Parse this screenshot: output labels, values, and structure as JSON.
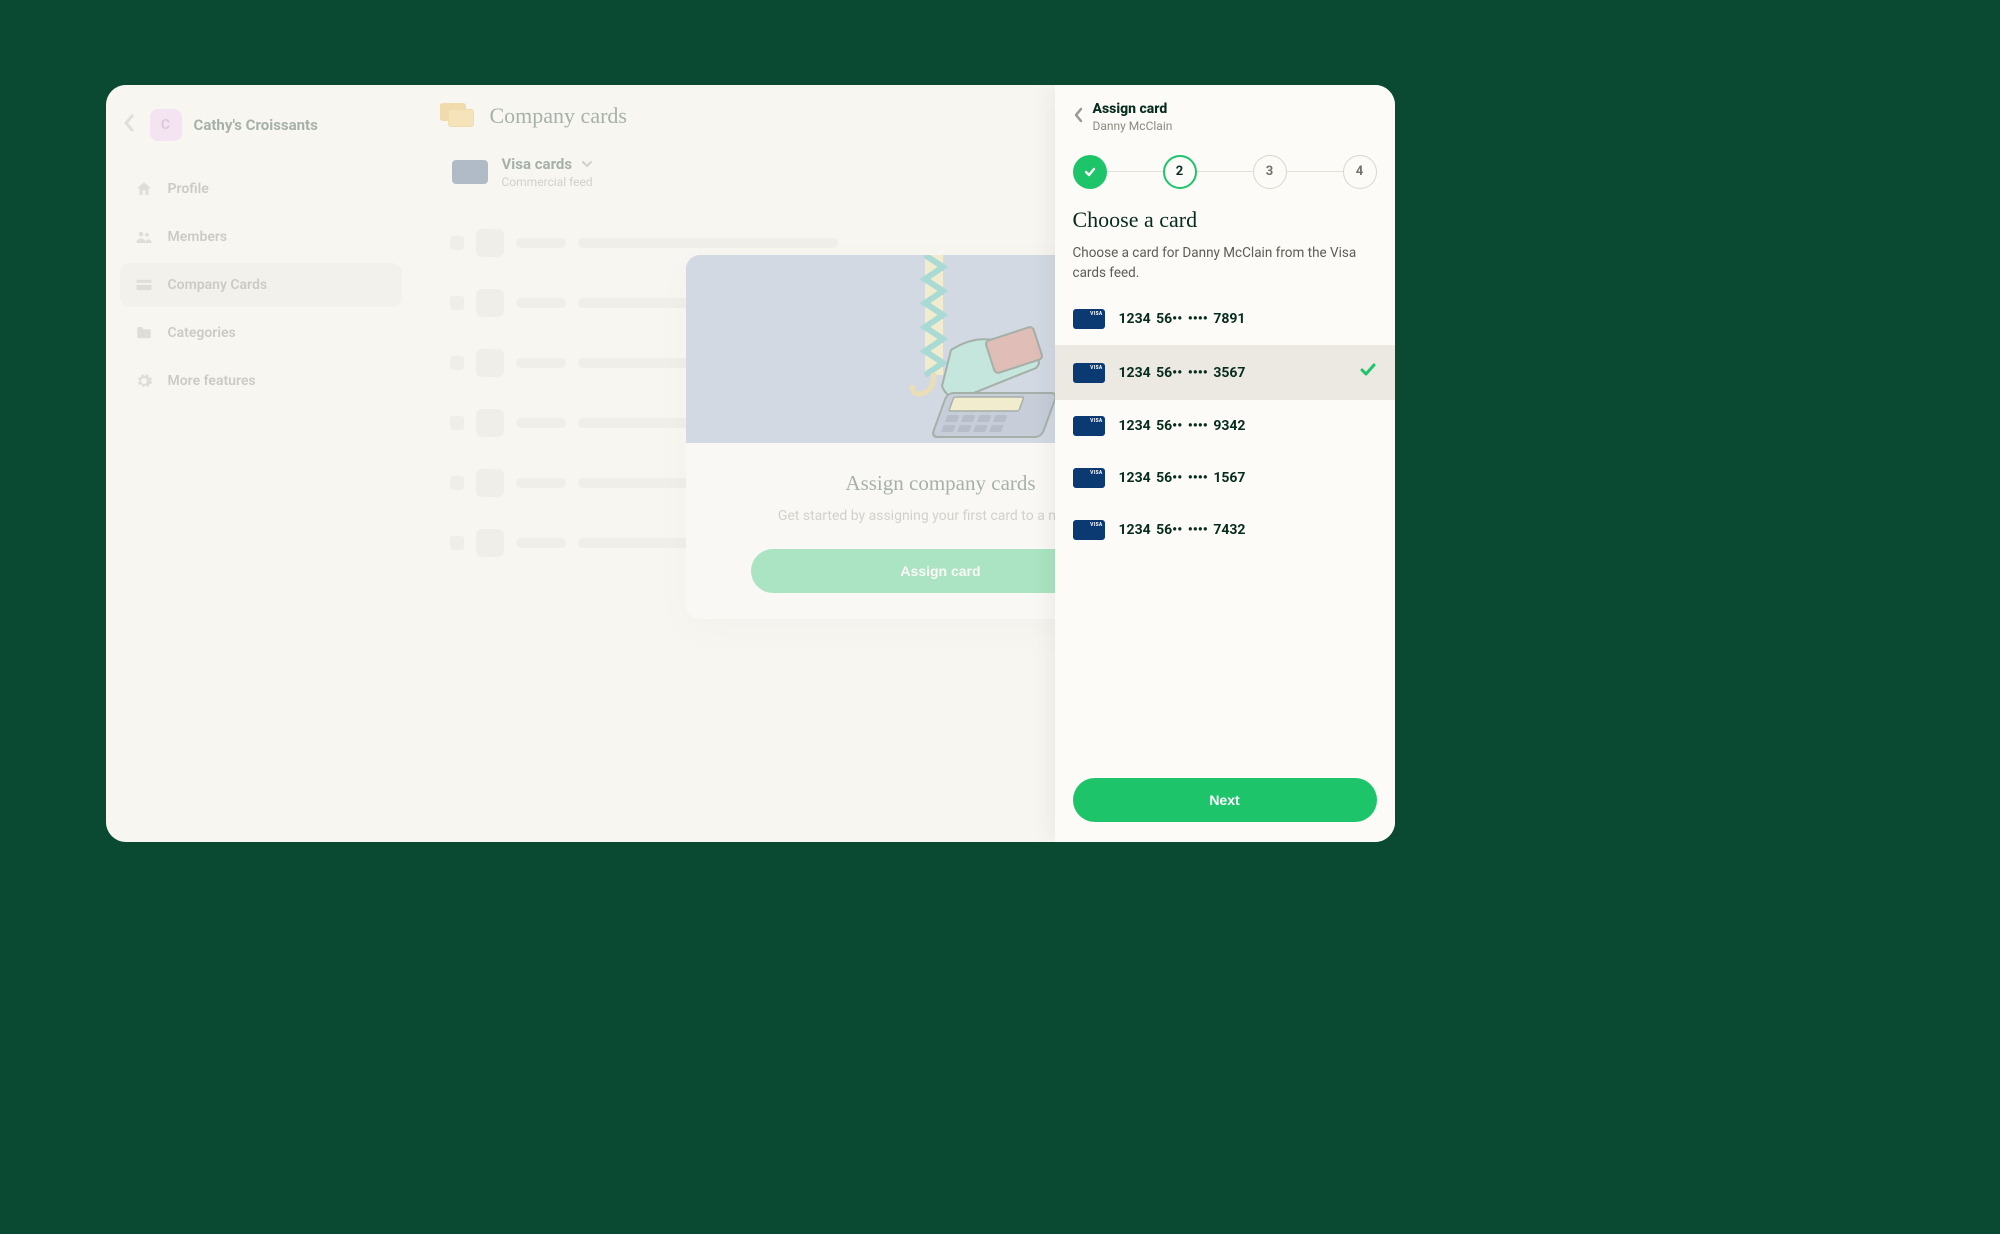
{
  "workspace": {
    "initial": "C",
    "name": "Cathy's Croissants"
  },
  "nav": {
    "profile": "Profile",
    "members": "Members",
    "company_cards": "Company Cards",
    "categories": "Categories",
    "more_features": "More features"
  },
  "main": {
    "title": "Company cards",
    "feed": {
      "name": "Visa cards",
      "subtitle": "Commercial feed"
    }
  },
  "onboard": {
    "title": "Assign company cards",
    "desc": "Get started by assigning your first card to a member.",
    "button": "Assign card"
  },
  "panel": {
    "title": "Assign card",
    "subtitle": "Danny McClain",
    "steps": {
      "s2": "2",
      "s3": "3",
      "s4": "4"
    },
    "heading": "Choose a card",
    "desc": "Choose a card for Danny McClain from the Visa cards feed.",
    "cards": {
      "c0": "1234 56•• •••• 7891",
      "c1": "1234 56•• •••• 3567",
      "c2": "1234 56•• •••• 9342",
      "c3": "1234 56•• •••• 1567",
      "c4": "1234 56•• •••• 7432"
    },
    "next": "Next"
  }
}
